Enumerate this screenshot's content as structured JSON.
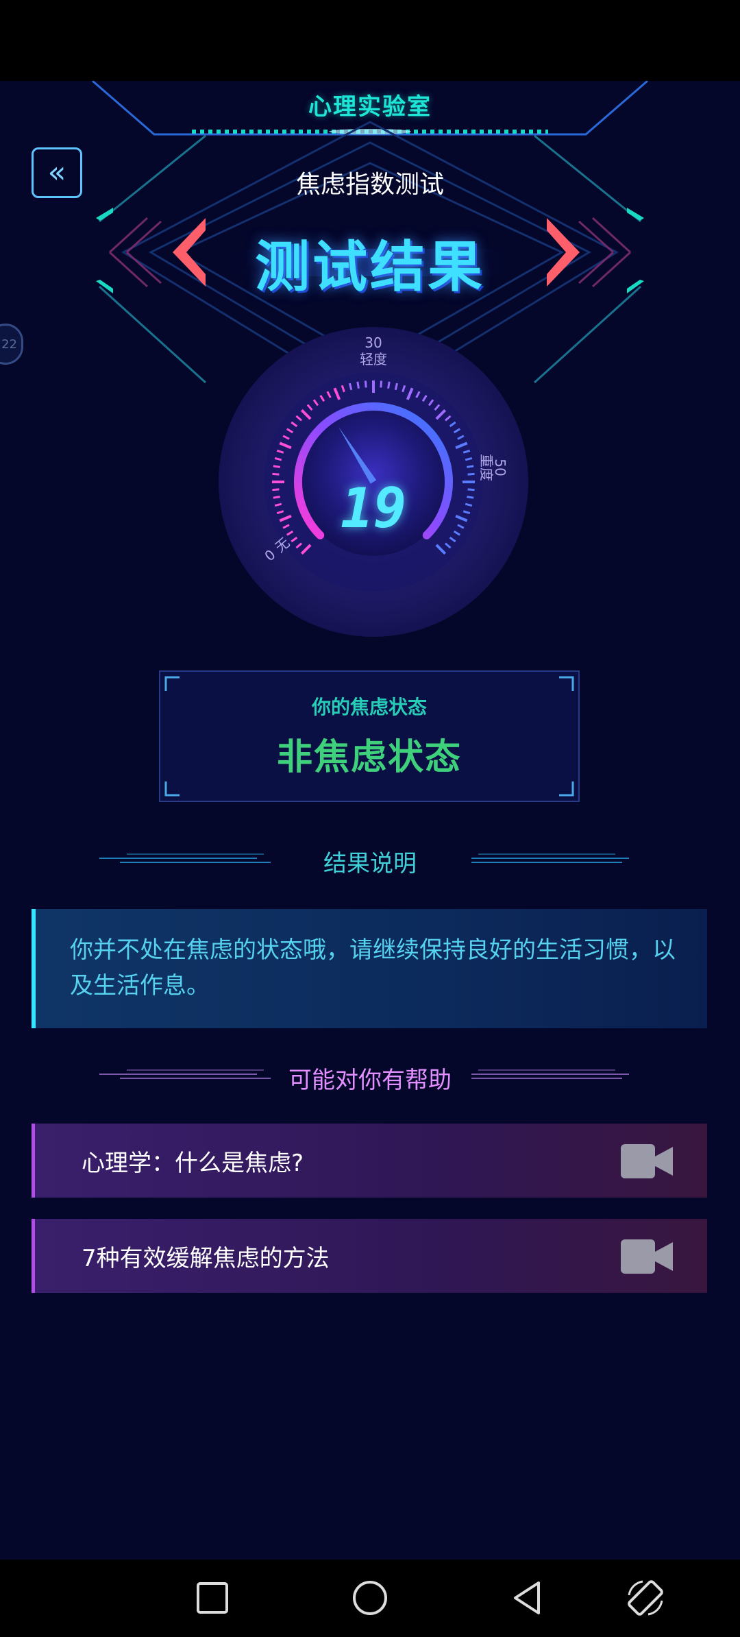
{
  "app": {
    "title": "心理实验室",
    "page_subtitle": "焦虑指数测试",
    "page_title": "测试结果",
    "side_tab_label": "22"
  },
  "gauge": {
    "value": "19",
    "label_top_num": "30",
    "label_top_text": "轻度",
    "label_right_num": "50",
    "label_right_text": "重度",
    "label_left_num": "0",
    "label_left_text": "无",
    "value_fraction": 0.38
  },
  "status": {
    "label": "你的焦虑状态",
    "value": "非焦虑状态"
  },
  "result": {
    "heading": "结果说明",
    "text": "你并不处在焦虑的状态哦，请继续保持良好的生活习惯，以及生活作息。"
  },
  "help": {
    "heading": "可能对你有帮助",
    "items": [
      {
        "label": "心理学：什么是焦虑?",
        "icon": "video-camera-icon"
      },
      {
        "label": "7种有效缓解焦虑的方法",
        "icon": "video-camera-icon"
      }
    ]
  },
  "colors": {
    "background": "#04062a",
    "accent_cyan": "#1ee6d6",
    "title_blue": "#3fe0ff",
    "status_green": "#3ed07a",
    "help_pink": "#e38fff"
  },
  "navbar": {
    "recent_icon": "square-icon",
    "home_icon": "circle-icon",
    "back_icon": "triangle-back-icon",
    "rotate_icon": "rotate-screen-icon"
  }
}
